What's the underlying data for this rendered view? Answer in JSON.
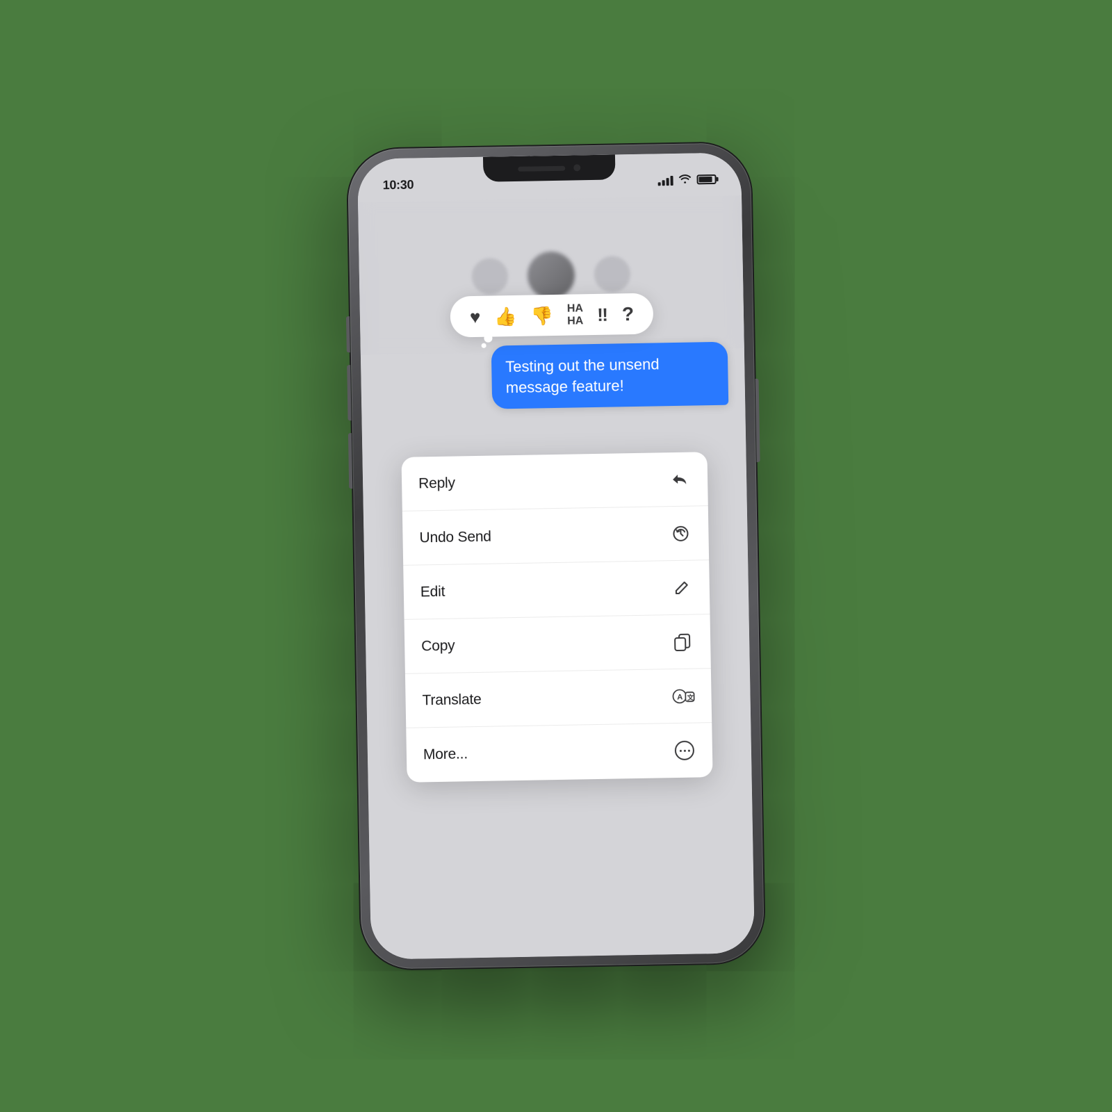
{
  "background": {
    "color": "#4a7c3f"
  },
  "status_bar": {
    "time": "10:30",
    "signal_label": "signal",
    "wifi_label": "wifi",
    "battery_label": "battery"
  },
  "reaction_bar": {
    "items": [
      {
        "id": "heart",
        "emoji": "♥",
        "label": "heart reaction"
      },
      {
        "id": "thumbs-up",
        "emoji": "👍",
        "label": "thumbs up reaction"
      },
      {
        "id": "thumbs-down",
        "emoji": "👎",
        "label": "thumbs down reaction"
      },
      {
        "id": "haha",
        "text": "HA\nHA",
        "label": "haha reaction"
      },
      {
        "id": "exclaim",
        "emoji": "‼",
        "label": "exclamation reaction"
      },
      {
        "id": "question",
        "emoji": "?",
        "label": "question reaction"
      }
    ]
  },
  "message": {
    "text": "Testing out the unsend message feature!",
    "sender": "self"
  },
  "context_menu": {
    "items": [
      {
        "id": "reply",
        "label": "Reply",
        "icon": "reply-icon"
      },
      {
        "id": "undo-send",
        "label": "Undo Send",
        "icon": "undo-send-icon"
      },
      {
        "id": "edit",
        "label": "Edit",
        "icon": "edit-icon"
      },
      {
        "id": "copy",
        "label": "Copy",
        "icon": "copy-icon"
      },
      {
        "id": "translate",
        "label": "Translate",
        "icon": "translate-icon"
      },
      {
        "id": "more",
        "label": "More...",
        "icon": "more-icon"
      }
    ]
  }
}
